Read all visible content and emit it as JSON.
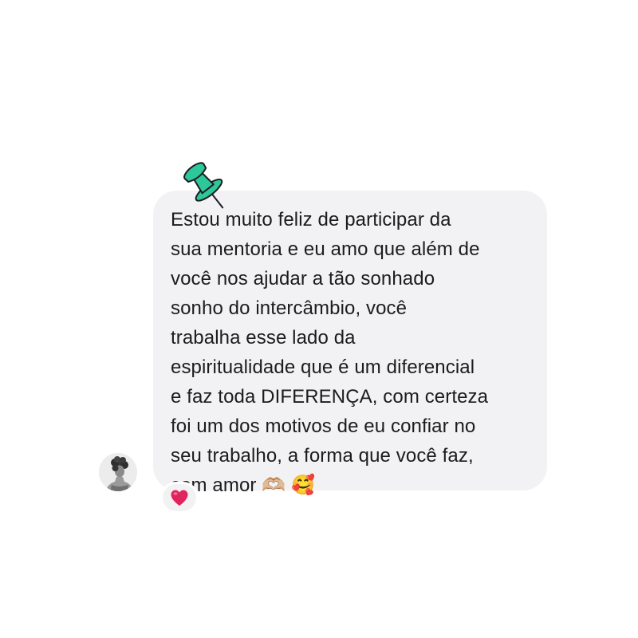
{
  "message": {
    "lines": [
      "Estou muito feliz de participar da",
      "sua mentoria e eu amo que além de",
      "você nos ajudar a tão sonhado",
      "sonho do intercâmbio, você",
      "trabalha esse lado da",
      "espiritualidade que é um diferencial",
      "e faz toda DIFERENÇA, com certeza",
      "foi um dos motivos de eu confiar no",
      "seu trabalho, a forma que você faz,",
      "com amor 🫶🏼 🥰"
    ]
  },
  "reaction": {
    "emoji": "❤️"
  },
  "decorations": {
    "pin_icon": "pushpin-icon",
    "pin_color": "#2ec79a",
    "avatar_icon": "user-avatar"
  },
  "colors": {
    "bubble": "#f2f2f4",
    "text": "#1c1c1e",
    "heart": "#e0245e"
  }
}
